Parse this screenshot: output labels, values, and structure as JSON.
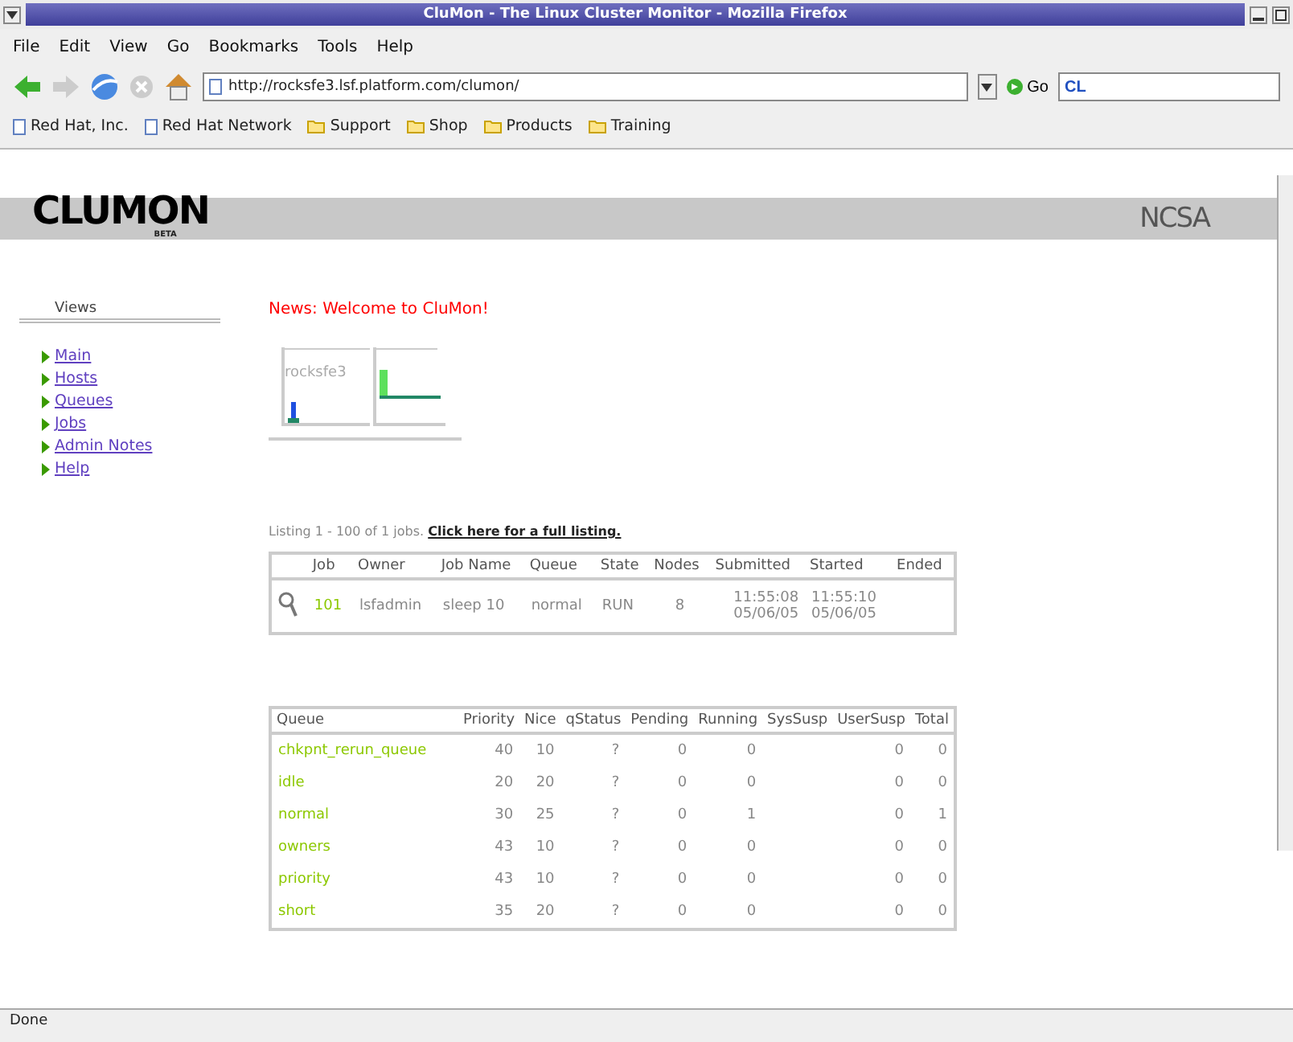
{
  "window": {
    "title": "CluMon - The Linux Cluster Monitor - Mozilla Firefox"
  },
  "menu": [
    "File",
    "Edit",
    "View",
    "Go",
    "Bookmarks",
    "Tools",
    "Help"
  ],
  "toolbar": {
    "url": "http://rocksfe3.lsf.platform.com/clumon/",
    "go": "Go",
    "search": "CL"
  },
  "bookmarks": [
    {
      "label": "Red Hat, Inc.",
      "kind": "page"
    },
    {
      "label": "Red Hat Network",
      "kind": "page"
    },
    {
      "label": "Support",
      "kind": "folder"
    },
    {
      "label": "Shop",
      "kind": "folder"
    },
    {
      "label": "Products",
      "kind": "folder"
    },
    {
      "label": "Training",
      "kind": "folder"
    }
  ],
  "header": {
    "logo": "CLUMON",
    "badge": "BETA",
    "partner": "NCSA"
  },
  "sidebar": {
    "title": "Views",
    "items": [
      "Main",
      "Hosts",
      "Queues",
      "Jobs",
      "Admin Notes",
      "Help"
    ]
  },
  "news": "News: Welcome to CluMon!",
  "host": {
    "name": "rocksfe3"
  },
  "listing": {
    "text": "Listing 1 - 100 of 1 jobs.",
    "link": "Click here for a full listing."
  },
  "jobs": {
    "columns": [
      "Job",
      "Owner",
      "Job Name",
      "Queue",
      "State",
      "Nodes",
      "Submitted",
      "Started",
      "Ended"
    ],
    "rows": [
      {
        "job": "101",
        "owner": "lsfadmin",
        "name": "sleep 10",
        "queue": "normal",
        "state": "RUN",
        "nodes": "8",
        "submitted": [
          "11:55:08",
          "05/06/05"
        ],
        "started": [
          "11:55:10",
          "05/06/05"
        ]
      }
    ]
  },
  "queues": {
    "columns": [
      "Queue",
      "Priority",
      "Nice",
      "qStatus",
      "Pending",
      "Running",
      "SysSusp",
      "UserSusp",
      "Total"
    ],
    "rows": [
      [
        "chkpnt_rerun_queue",
        "40",
        "10",
        "?",
        "0",
        "0",
        "",
        "0",
        "0"
      ],
      [
        "idle",
        "20",
        "20",
        "?",
        "0",
        "0",
        "",
        "0",
        "0"
      ],
      [
        "normal",
        "30",
        "25",
        "?",
        "0",
        "1",
        "",
        "0",
        "1"
      ],
      [
        "owners",
        "43",
        "10",
        "?",
        "0",
        "0",
        "",
        "0",
        "0"
      ],
      [
        "priority",
        "43",
        "10",
        "?",
        "0",
        "0",
        "",
        "0",
        "0"
      ],
      [
        "short",
        "35",
        "20",
        "?",
        "0",
        "0",
        "",
        "0",
        "0"
      ]
    ]
  },
  "status_bar": "Done"
}
